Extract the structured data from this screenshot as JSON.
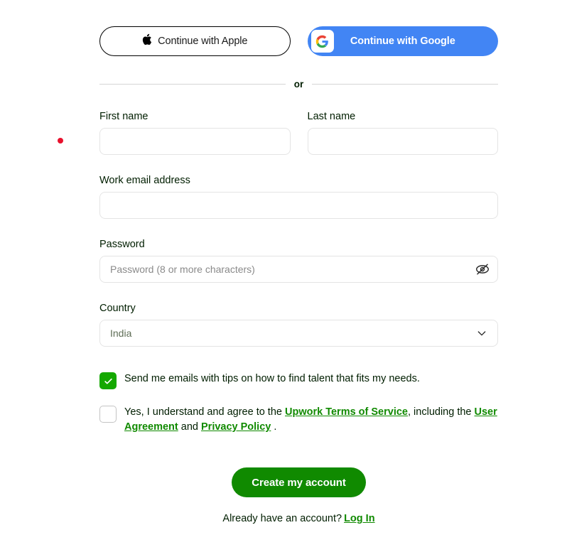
{
  "colors": {
    "google_blue": "#4285f4",
    "upwork_green": "#108a00",
    "checkbox_green": "#14a800",
    "link_green": "#108a00",
    "cursor_dot_red": "#e8112d",
    "input_border": "#e4e4e4",
    "page_background": "#ffffff"
  },
  "social": {
    "apple": {
      "label": "Continue with Apple",
      "icon": "apple-logo-icon",
      "glyph": ""
    },
    "google": {
      "label": "Continue with Google",
      "icon": "google-logo-icon"
    }
  },
  "divider": {
    "text": "or"
  },
  "form": {
    "first_name": {
      "label": "First name",
      "value": "",
      "placeholder": ""
    },
    "last_name": {
      "label": "Last name",
      "value": "",
      "placeholder": ""
    },
    "email": {
      "label": "Work email address",
      "value": "",
      "placeholder": ""
    },
    "password": {
      "label": "Password",
      "value": "",
      "placeholder": "Password (8 or more characters)",
      "toggle_icon": "eye-slash-icon"
    },
    "country": {
      "label": "Country",
      "value": "India",
      "chevron_icon": "chevron-down-icon"
    }
  },
  "consents": {
    "emails": {
      "checked": true,
      "text": "Send me emails with tips on how to find talent that fits my needs."
    },
    "terms": {
      "checked": false,
      "text_part_1": "Yes, I understand and agree to the ",
      "link_terms": "Upwork Terms of Service",
      "text_part_2": ", including the ",
      "link_user_agreement": "User Agreement",
      "text_part_3": " and ",
      "link_privacy": "Privacy Policy",
      "text_part_4": " ."
    }
  },
  "submit": {
    "label": "Create my account"
  },
  "footer": {
    "prompt": "Already have an account?",
    "login_link": "Log In"
  }
}
